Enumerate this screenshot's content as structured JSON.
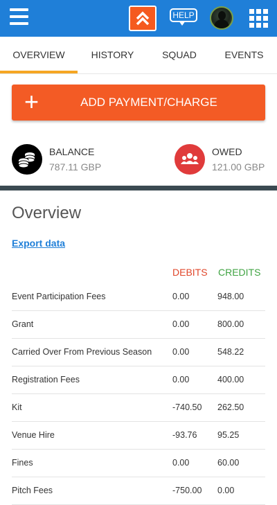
{
  "topbar": {
    "help_label": "HELP",
    "icons": {
      "menu": "hamburger-menu-icon",
      "logo": "double-chevron-up-icon",
      "help": "help-bubble-icon",
      "avatar": "user-avatar",
      "apps": "apps-grid-icon"
    },
    "colors": {
      "bar": "#1f7fd8",
      "logo": "#f55a1f"
    }
  },
  "tabs": [
    {
      "label": "OVERVIEW",
      "active": true
    },
    {
      "label": "HISTORY",
      "active": false
    },
    {
      "label": "SQUAD",
      "active": false
    },
    {
      "label": "EVENTS",
      "active": false
    }
  ],
  "add_button": {
    "label": "ADD PAYMENT/CHARGE",
    "icon": "plus-icon",
    "color": "#f35b25"
  },
  "balance": {
    "title": "BALANCE",
    "value": "787.11 GBP",
    "icon": "coin-stack-icon"
  },
  "owed": {
    "title": "OWED",
    "value": "121.00 GBP",
    "icon": "group-icon",
    "color": "#e03b3b"
  },
  "overview": {
    "title": "Overview",
    "export_label": "Export data",
    "debits_header": "DEBITS",
    "credits_header": "CREDITS",
    "rows": [
      {
        "name": "Event Participation Fees",
        "debit": "0.00",
        "credit": "948.00"
      },
      {
        "name": "Grant",
        "debit": "0.00",
        "credit": "800.00"
      },
      {
        "name": "Carried Over From Previous Season",
        "debit": "0.00",
        "credit": "548.22"
      },
      {
        "name": "Registration Fees",
        "debit": "0.00",
        "credit": "400.00"
      },
      {
        "name": "Kit",
        "debit": "-740.50",
        "credit": "262.50"
      },
      {
        "name": "Venue Hire",
        "debit": "-93.76",
        "credit": "95.25"
      },
      {
        "name": "Fines",
        "debit": "0.00",
        "credit": "60.00"
      },
      {
        "name": "Pitch Fees",
        "debit": "-750.00",
        "credit": "0.00"
      }
    ]
  }
}
